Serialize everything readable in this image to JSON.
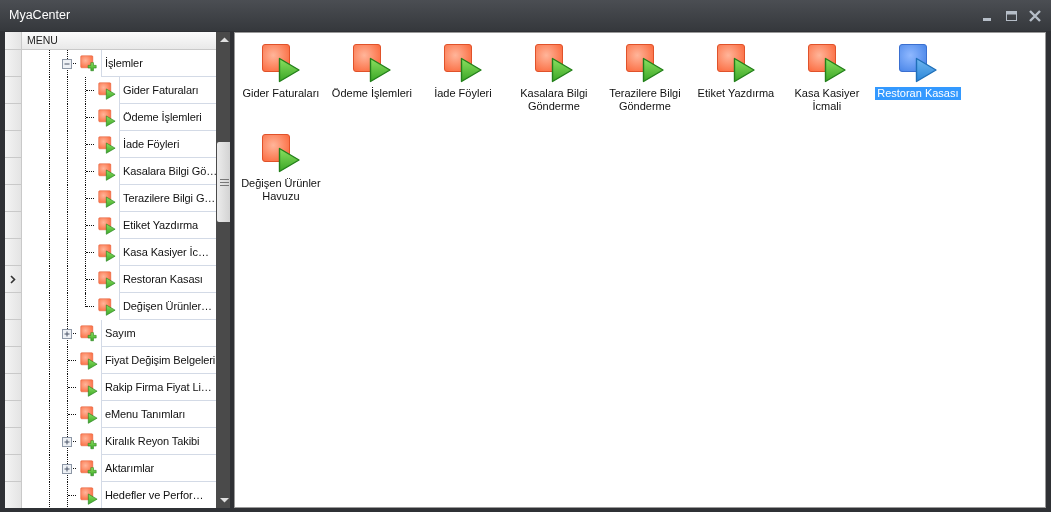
{
  "window": {
    "title": "MyaCenter"
  },
  "tree": {
    "header": "MENU",
    "items": [
      {
        "label": "İşlemler",
        "kind": "group",
        "expanded": true,
        "selected": false,
        "children": [
          {
            "label": "Gider Faturaları",
            "kind": "leaf",
            "selected": false
          },
          {
            "label": "Ödeme İşlemleri",
            "kind": "leaf",
            "selected": false
          },
          {
            "label": "İade Föyleri",
            "kind": "leaf",
            "selected": false
          },
          {
            "label": "Kasalara Bilgi Gö…",
            "kind": "leaf",
            "selected": false
          },
          {
            "label": "Terazilere Bilgi G…",
            "kind": "leaf",
            "selected": false
          },
          {
            "label": "Etiket Yazdırma",
            "kind": "leaf",
            "selected": false
          },
          {
            "label": "Kasa Kasiyer İc…",
            "kind": "leaf",
            "selected": false
          },
          {
            "label": "Restoran Kasası",
            "kind": "leaf",
            "selected": true
          },
          {
            "label": "Değişen Ürünler…",
            "kind": "leaf",
            "selected": false
          }
        ]
      },
      {
        "label": "Sayım",
        "kind": "group",
        "expanded": false,
        "selected": false
      },
      {
        "label": "Fiyat Değişim Belgeleri",
        "kind": "leaf",
        "selected": false
      },
      {
        "label": "Rakip Firma Fiyat Li…",
        "kind": "leaf",
        "selected": false
      },
      {
        "label": "eMenu Tanımları",
        "kind": "leaf",
        "selected": false
      },
      {
        "label": "Kiralık Reyon Takibi",
        "kind": "group",
        "expanded": false,
        "selected": false
      },
      {
        "label": "Aktarımlar",
        "kind": "group",
        "expanded": false,
        "selected": false
      },
      {
        "label": "Hedefler ve Perfor…",
        "kind": "leaf",
        "selected": false
      }
    ]
  },
  "launcher": {
    "items": [
      {
        "label": "Gider Faturaları",
        "selected": false
      },
      {
        "label": "Ödeme İşlemleri",
        "selected": false
      },
      {
        "label": "İade Föyleri",
        "selected": false
      },
      {
        "label": "Kasalara Bilgi Gönderme",
        "selected": false
      },
      {
        "label": "Terazilere Bilgi Gönderme",
        "selected": false
      },
      {
        "label": "Etiket Yazdırma",
        "selected": false
      },
      {
        "label": "Kasa Kasiyer İcmali",
        "selected": false
      },
      {
        "label": "Restoran Kasası",
        "selected": true
      },
      {
        "label": "Değişen Ürünler Havuzu",
        "selected": false
      }
    ]
  }
}
